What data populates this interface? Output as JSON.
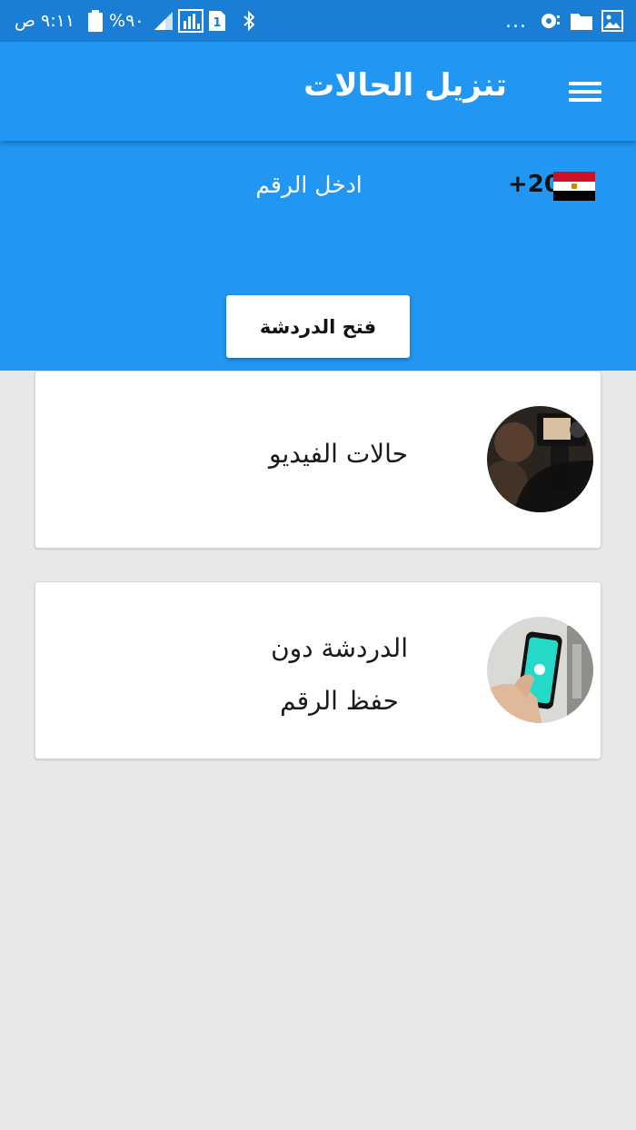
{
  "status_bar": {
    "time": "٩:١١ ص",
    "battery": "%٩٠",
    "sim_slot": "1",
    "overflow": "...",
    "icons": [
      "battery-icon",
      "signal-icon",
      "data-activity-icon",
      "sim-icon",
      "bluetooth-icon",
      "notification-icon",
      "folder-icon",
      "image-icon"
    ]
  },
  "app_bar": {
    "title": "تنزيل الحالات",
    "menu_icon": "hamburger-menu-icon"
  },
  "input_area": {
    "country_code": "+20",
    "flag": "egypt-flag-icon",
    "phone_placeholder": "ادخل الرقم",
    "open_chat_label": "فتح الدردشة"
  },
  "cards": [
    {
      "label": "حالات الفيديو",
      "thumbnail": "video-camera-photo"
    },
    {
      "label_line1": "الدردشة دون",
      "label_line2": "حفظ الرقم",
      "thumbnail": "whatsapp-phone-photo"
    }
  ],
  "colors": {
    "primary": "#2196f3",
    "status_bar": "#1a7fd4",
    "background": "#e8e8e8",
    "whatsapp_accent": "#25d366"
  }
}
